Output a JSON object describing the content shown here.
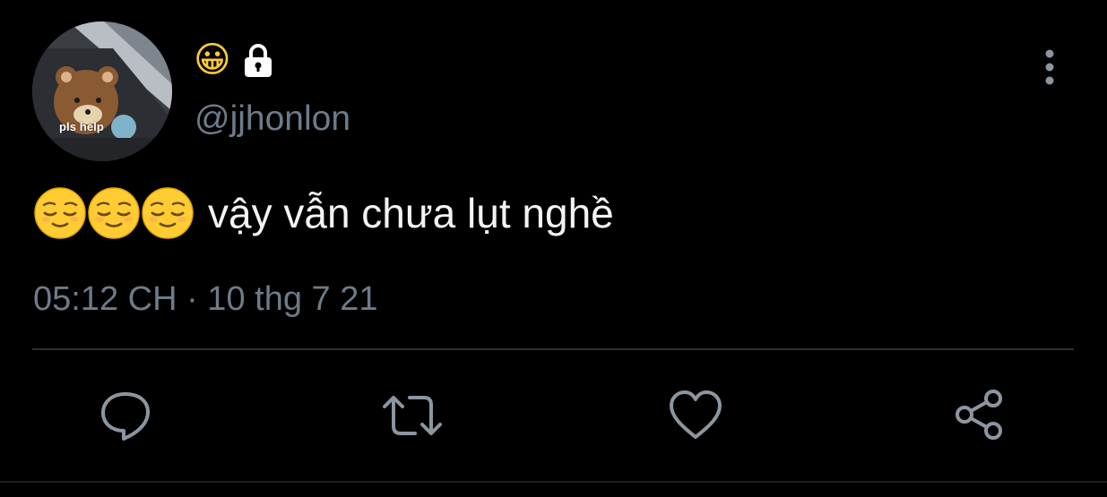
{
  "author": {
    "display_name_emoji": "😀",
    "handle": "@jjhonlon",
    "avatar_caption": "pls help",
    "protected_icon": "lock-icon"
  },
  "tweet": {
    "text": "vậy vẫn chưa lụt nghề",
    "leading_emojis": [
      "relieved-face",
      "relieved-face",
      "relieved-face"
    ],
    "timestamp": "05:12 CH · 10 thg 7 21"
  },
  "actions": {
    "reply_icon": "comment-icon",
    "retweet_icon": "retweet-icon",
    "like_icon": "heart-icon",
    "share_icon": "share-icon",
    "more_icon": "more-vertical-icon"
  },
  "colors": {
    "background": "#000000",
    "text": "#f2f3f5",
    "secondary_text": "#6e7b89",
    "divider": "#2b2f33",
    "emoji_yellow": "#ffcc33"
  }
}
